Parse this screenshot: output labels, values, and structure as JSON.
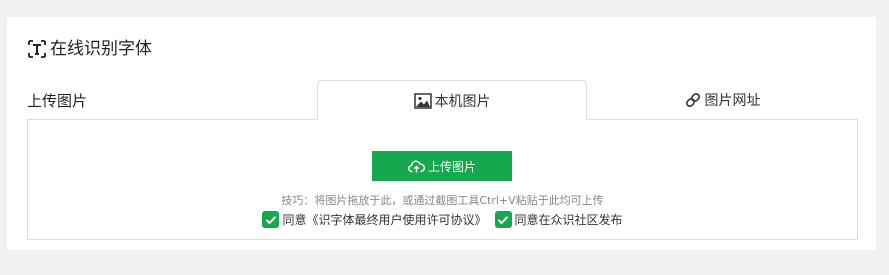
{
  "header": {
    "title": "在线识别字体",
    "title_icon": "text-recognition-icon"
  },
  "upload": {
    "label": "上传图片",
    "tabs": [
      {
        "label": "本机图片",
        "icon": "image-icon",
        "active": true
      },
      {
        "label": "图片网址",
        "icon": "link-icon",
        "active": false
      }
    ],
    "button_label": "上传图片",
    "button_icon": "cloud-upload-icon",
    "tip": "技巧：将图片拖放于此，或通过截图工具Ctrl+V粘贴于此均可上传",
    "agreements": [
      {
        "label": "同意《识字体最终用户使用许可协议》",
        "checked": true
      },
      {
        "label": "同意在众识社区发布",
        "checked": true
      }
    ]
  },
  "colors": {
    "accent": "#17a84f",
    "background": "#f1f1f1",
    "panel": "#ffffff",
    "border": "#dcdcdc",
    "tip_text": "#888888"
  }
}
